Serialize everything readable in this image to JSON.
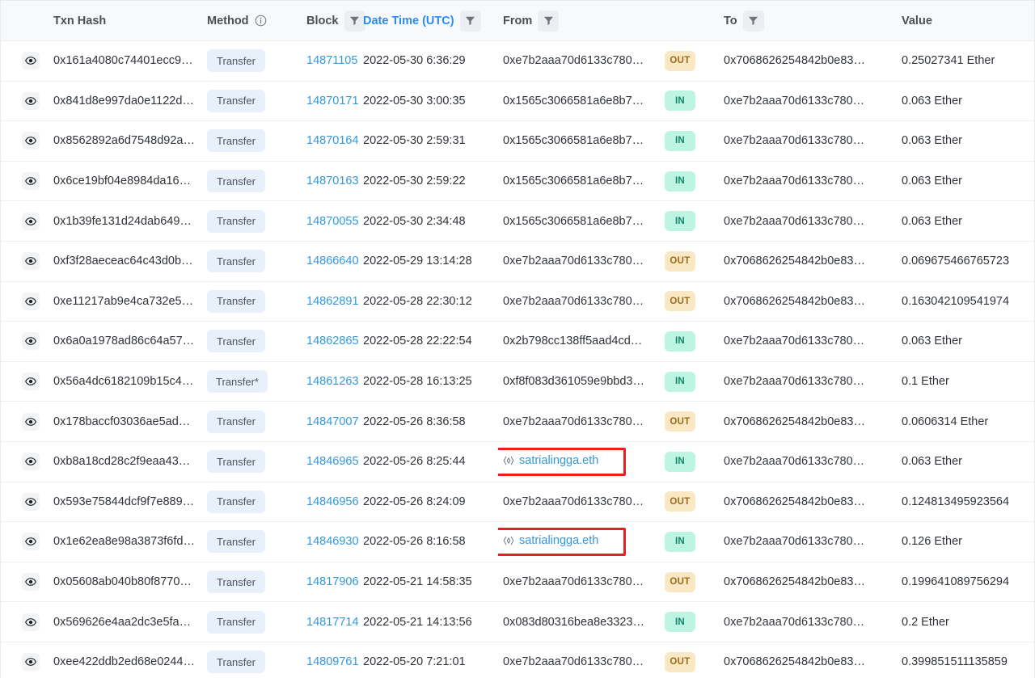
{
  "table": {
    "columns": [
      {
        "key": "eye",
        "label": "",
        "filter": false,
        "info": false,
        "link": false
      },
      {
        "key": "hash",
        "label": "Txn Hash",
        "filter": false,
        "info": false,
        "link": false
      },
      {
        "key": "method",
        "label": "Method",
        "filter": false,
        "info": true,
        "link": false
      },
      {
        "key": "block",
        "label": "Block",
        "filter": true,
        "info": false,
        "link": false
      },
      {
        "key": "date",
        "label": "Date Time (UTC)",
        "filter": true,
        "info": false,
        "link": true
      },
      {
        "key": "from",
        "label": "From",
        "filter": true,
        "info": false,
        "link": false
      },
      {
        "key": "dir",
        "label": "",
        "filter": false,
        "info": false,
        "link": false
      },
      {
        "key": "to",
        "label": "To",
        "filter": true,
        "info": false,
        "link": false
      },
      {
        "key": "value",
        "label": "Value",
        "filter": false,
        "info": false,
        "link": false
      }
    ],
    "icons": {
      "eye": "eye-icon",
      "filter": "filter-icon",
      "info": "info-icon",
      "ens": "ens-code-brackets-icon"
    },
    "colors": {
      "link": "#3498db",
      "header_link": "#2a8ded",
      "in_badge_bg": "#bdf4e2",
      "in_badge_text": "#14866a",
      "out_badge_bg": "#fae7c3",
      "out_badge_text": "#9b6b1a",
      "method_badge_bg": "#e8f1fb",
      "highlight_border": "#ee1d1d",
      "header_bg": "#f8f9fb"
    },
    "rows": [
      {
        "hash": "0x161a4080c74401ecc9…",
        "method": "Transfer",
        "block": "14871105",
        "date": "2022-05-30 6:36:29",
        "from": "0xe7b2aaa70d6133c780…",
        "from_link": false,
        "from_ens": false,
        "from_highlight": false,
        "dir": "OUT",
        "to": "0x7068626254842b0e83…",
        "to_link": true,
        "value": "0.25027341 Ether"
      },
      {
        "hash": "0x841d8e997da0e1122d…",
        "method": "Transfer",
        "block": "14870171",
        "date": "2022-05-30 3:00:35",
        "from": "0x1565c3066581a6e8b7…",
        "from_link": true,
        "from_ens": false,
        "from_highlight": false,
        "dir": "IN",
        "to": "0xe7b2aaa70d6133c780…",
        "to_link": false,
        "value": "0.063 Ether"
      },
      {
        "hash": "0x8562892a6d7548d92a…",
        "method": "Transfer",
        "block": "14870164",
        "date": "2022-05-30 2:59:31",
        "from": "0x1565c3066581a6e8b7…",
        "from_link": true,
        "from_ens": false,
        "from_highlight": false,
        "dir": "IN",
        "to": "0xe7b2aaa70d6133c780…",
        "to_link": false,
        "value": "0.063 Ether"
      },
      {
        "hash": "0x6ce19bf04e8984da16…",
        "method": "Transfer",
        "block": "14870163",
        "date": "2022-05-30 2:59:22",
        "from": "0x1565c3066581a6e8b7…",
        "from_link": true,
        "from_ens": false,
        "from_highlight": false,
        "dir": "IN",
        "to": "0xe7b2aaa70d6133c780…",
        "to_link": false,
        "value": "0.063 Ether"
      },
      {
        "hash": "0x1b39fe131d24dab649…",
        "method": "Transfer",
        "block": "14870055",
        "date": "2022-05-30 2:34:48",
        "from": "0x1565c3066581a6e8b7…",
        "from_link": true,
        "from_ens": false,
        "from_highlight": false,
        "dir": "IN",
        "to": "0xe7b2aaa70d6133c780…",
        "to_link": false,
        "value": "0.063 Ether"
      },
      {
        "hash": "0xf3f28aeceac64c43d0b…",
        "method": "Transfer",
        "block": "14866640",
        "date": "2022-05-29 13:14:28",
        "from": "0xe7b2aaa70d6133c780…",
        "from_link": false,
        "from_ens": false,
        "from_highlight": false,
        "dir": "OUT",
        "to": "0x7068626254842b0e83…",
        "to_link": true,
        "value": "0.069675466765723"
      },
      {
        "hash": "0xe11217ab9e4ca732e5…",
        "method": "Transfer",
        "block": "14862891",
        "date": "2022-05-28 22:30:12",
        "from": "0xe7b2aaa70d6133c780…",
        "from_link": false,
        "from_ens": false,
        "from_highlight": false,
        "dir": "OUT",
        "to": "0x7068626254842b0e83…",
        "to_link": true,
        "value": "0.163042109541974"
      },
      {
        "hash": "0x6a0a1978ad86c64a57…",
        "method": "Transfer",
        "block": "14862865",
        "date": "2022-05-28 22:22:54",
        "from": "0x2b798cc138ff5aad4cd…",
        "from_link": true,
        "from_ens": false,
        "from_highlight": false,
        "dir": "IN",
        "to": "0xe7b2aaa70d6133c780…",
        "to_link": false,
        "value": "0.063 Ether"
      },
      {
        "hash": "0x56a4dc6182109b15c4…",
        "method": "Transfer*",
        "block": "14861263",
        "date": "2022-05-28 16:13:25",
        "from": "0xf8f083d361059e9bbd3…",
        "from_link": true,
        "from_ens": false,
        "from_highlight": false,
        "dir": "IN",
        "to": "0xe7b2aaa70d6133c780…",
        "to_link": false,
        "value": "0.1 Ether"
      },
      {
        "hash": "0x178baccf03036ae5ad…",
        "method": "Transfer",
        "block": "14847007",
        "date": "2022-05-26 8:36:58",
        "from": "0xe7b2aaa70d6133c780…",
        "from_link": false,
        "from_ens": false,
        "from_highlight": false,
        "dir": "OUT",
        "to": "0x7068626254842b0e83…",
        "to_link": true,
        "value": "0.0606314 Ether"
      },
      {
        "hash": "0xb8a18cd28c2f9eaa43…",
        "method": "Transfer",
        "block": "14846965",
        "date": "2022-05-26 8:25:44",
        "from": "satrialingga.eth",
        "from_link": true,
        "from_ens": true,
        "from_highlight": true,
        "dir": "IN",
        "to": "0xe7b2aaa70d6133c780…",
        "to_link": false,
        "value": "0.063 Ether"
      },
      {
        "hash": "0x593e75844dcf9f7e889…",
        "method": "Transfer",
        "block": "14846956",
        "date": "2022-05-26 8:24:09",
        "from": "0xe7b2aaa70d6133c780…",
        "from_link": false,
        "from_ens": false,
        "from_highlight": false,
        "dir": "OUT",
        "to": "0x7068626254842b0e83…",
        "to_link": true,
        "value": "0.124813495923564"
      },
      {
        "hash": "0x1e62ea8e98a3873f6fd…",
        "method": "Transfer",
        "block": "14846930",
        "date": "2022-05-26 8:16:58",
        "from": "satrialingga.eth",
        "from_link": true,
        "from_ens": true,
        "from_highlight": true,
        "dir": "IN",
        "to": "0xe7b2aaa70d6133c780…",
        "to_link": false,
        "value": "0.126 Ether"
      },
      {
        "hash": "0x05608ab040b80f8770…",
        "method": "Transfer",
        "block": "14817906",
        "date": "2022-05-21 14:58:35",
        "from": "0xe7b2aaa70d6133c780…",
        "from_link": false,
        "from_ens": false,
        "from_highlight": false,
        "dir": "OUT",
        "to": "0x7068626254842b0e83…",
        "to_link": true,
        "value": "0.199641089756294"
      },
      {
        "hash": "0x569626e4aa2dc3e5fa…",
        "method": "Transfer",
        "block": "14817714",
        "date": "2022-05-21 14:13:56",
        "from": "0x083d80316bea8e3323…",
        "from_link": true,
        "from_ens": false,
        "from_highlight": false,
        "dir": "IN",
        "to": "0xe7b2aaa70d6133c780…",
        "to_link": false,
        "value": "0.2 Ether"
      },
      {
        "hash": "0xee422ddb2ed68e0244…",
        "method": "Transfer",
        "block": "14809761",
        "date": "2022-05-20 7:21:01",
        "from": "0xe7b2aaa70d6133c780…",
        "from_link": false,
        "from_ens": false,
        "from_highlight": false,
        "dir": "OUT",
        "to": "0x7068626254842b0e83…",
        "to_link": true,
        "value": "0.399851511135859"
      }
    ]
  }
}
